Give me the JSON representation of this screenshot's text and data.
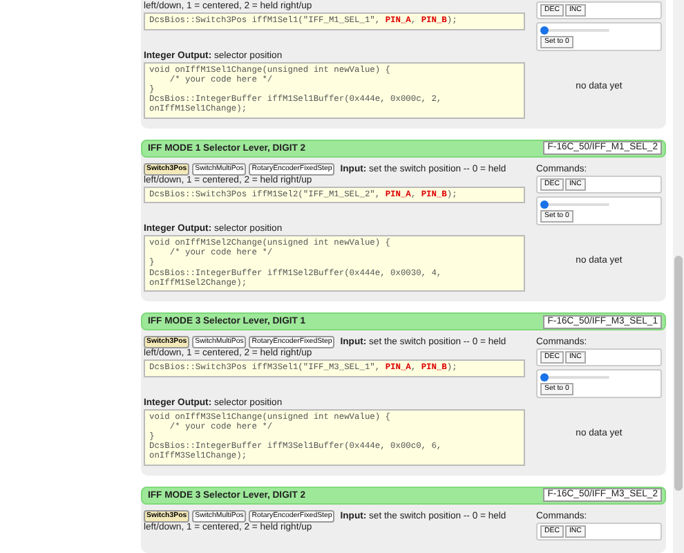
{
  "cards": [
    {
      "description": [
        "left/down, 1 = centered, 2 = held right/up"
      ],
      "input_code": [
        {
          "kind": "plain",
          "text": "DcsBios::Switch3Pos iffM1Sel1(\"IFF_M1_SEL_1\", "
        },
        {
          "kind": "pin",
          "text": "PIN_A"
        },
        {
          "kind": "plain",
          "text": ", "
        },
        {
          "kind": "pin",
          "text": "PIN_B"
        },
        {
          "kind": "plain",
          "text": ");"
        }
      ],
      "buttons": [
        "DEC",
        "INC"
      ],
      "slider": {
        "level": 0
      },
      "set_button": "Set to 0",
      "output_label": "**Integer Output:** selector position",
      "output_code": [
        "void onIffM1Sel1Change(unsigned int newValue) {",
        "    /* your code here */",
        "}",
        "DcsBios::IntegerBuffer iffM1Sel1Buffer(0x444e, 0x000c, 2,",
        "onIffM1Sel1Change);"
      ],
      "output_value": "no data yet"
    },
    {
      "title": "IFF MODE 1 Selector Lever, DIGIT 2",
      "id": "F-16C_50/IFF_M1_SEL_2",
      "tabs": [
        {
          "label": "Switch3Pos",
          "selected": true
        },
        {
          "label": "SwitchMultiPos",
          "selected": false
        },
        {
          "label": "RotaryEncoderFixedStep",
          "selected": false
        }
      ],
      "description": [
        "**Input:** set the switch position -- 0 = held",
        "left/down, 1 = centered, 2 = held right/up"
      ],
      "input_code": [
        {
          "kind": "plain",
          "text": "DcsBios::Switch3Pos iffM1Sel2(\"IFF_M1_SEL_2\", "
        },
        {
          "kind": "pin",
          "text": "PIN_A"
        },
        {
          "kind": "plain",
          "text": ", "
        },
        {
          "kind": "pin",
          "text": "PIN_B"
        },
        {
          "kind": "plain",
          "text": ");"
        }
      ],
      "commands_label": "Commands:",
      "buttons": [
        "DEC",
        "INC"
      ],
      "slider": {
        "level": 0
      },
      "set_button": "Set to 0",
      "output_label": "**Integer Output:** selector position",
      "output_code": [
        "void onIffM1Sel2Change(unsigned int newValue) {",
        "    /* your code here */",
        "}",
        "DcsBios::IntegerBuffer iffM1Sel2Buffer(0x444e, 0x0030, 4,",
        "onIffM1Sel2Change);"
      ],
      "output_value": "no data yet"
    },
    {
      "title": "IFF MODE 3 Selector Lever, DIGIT 1",
      "id": "F-16C_50/IFF_M3_SEL_1",
      "tabs": [
        {
          "label": "Switch3Pos",
          "selected": true
        },
        {
          "label": "SwitchMultiPos",
          "selected": false
        },
        {
          "label": "RotaryEncoderFixedStep",
          "selected": false
        }
      ],
      "description": [
        "**Input:** set the switch position -- 0 = held",
        "left/down, 1 = centered, 2 = held right/up"
      ],
      "input_code": [
        {
          "kind": "plain",
          "text": "DcsBios::Switch3Pos iffM3Sel1(\"IFF_M3_SEL_1\", "
        },
        {
          "kind": "pin",
          "text": "PIN_A"
        },
        {
          "kind": "plain",
          "text": ", "
        },
        {
          "kind": "pin",
          "text": "PIN_B"
        },
        {
          "kind": "plain",
          "text": ");"
        }
      ],
      "commands_label": "Commands:",
      "buttons": [
        "DEC",
        "INC"
      ],
      "slider": {
        "level": 0
      },
      "set_button": "Set to 0",
      "output_label": "**Integer Output:** selector position",
      "output_code": [
        "void onIffM3Sel1Change(unsigned int newValue) {",
        "    /* your code here */",
        "}",
        "DcsBios::IntegerBuffer iffM3Sel1Buffer(0x444e, 0x00c0, 6,",
        "onIffM3Sel1Change);"
      ],
      "output_value": "no data yet"
    },
    {
      "title": "IFF MODE 3 Selector Lever, DIGIT 2",
      "id": "F-16C_50/IFF_M3_SEL_2",
      "tabs": [
        {
          "label": "Switch3Pos",
          "selected": true
        },
        {
          "label": "SwitchMultiPos",
          "selected": false
        },
        {
          "label": "RotaryEncoderFixedStep",
          "selected": false
        }
      ],
      "description": [
        "**Input:** set the switch position -- 0 = held",
        "left/down, 1 = centered, 2 = held right/up"
      ],
      "commands_label": "Commands:",
      "buttons": [
        "DEC",
        "INC"
      ]
    }
  ]
}
